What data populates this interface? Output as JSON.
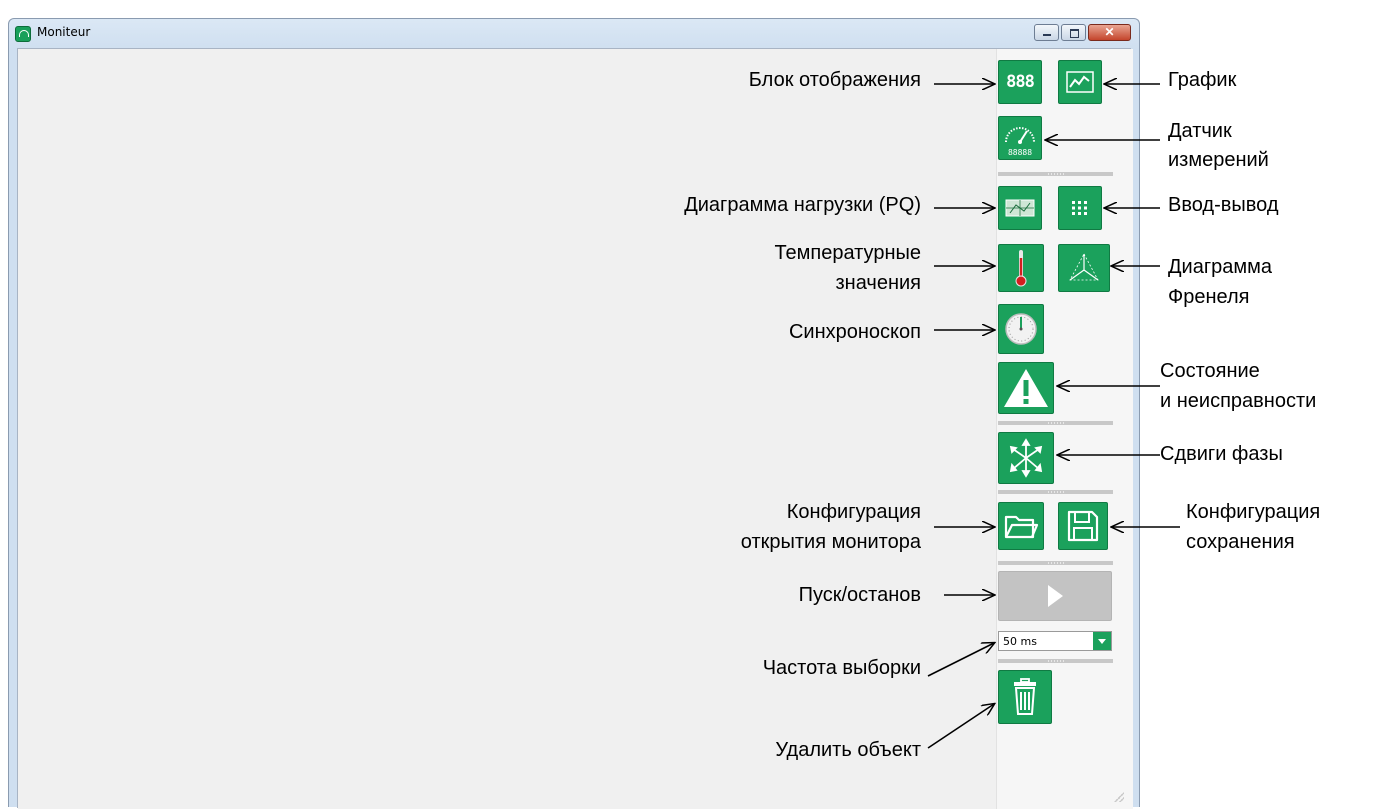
{
  "window": {
    "title": "Moniteur",
    "controls": {
      "minimize": "minimize",
      "maximize": "maximize",
      "close": "close"
    }
  },
  "toolbar": {
    "display_block_icon_text": "888",
    "gauge_digits": "88888",
    "sampling_rate": {
      "selected": "50 ms"
    }
  },
  "annotations": {
    "display_block": "Блок отображения",
    "chart": "График",
    "gauge_line1": "Датчик",
    "gauge_line2": "измерений",
    "pq_diagram": "Диаграмма нагрузки (PQ)",
    "io": "Ввод-вывод",
    "temp_line1": "Температурные",
    "temp_line2": "значения",
    "fresnel_line1": "Диаграмма",
    "fresnel_line2": "Френеля",
    "synchroscope": "Синхроноскоп",
    "status_line1": "Состояние",
    "status_line2": "и неисправности",
    "phase_shifts": "Сдвиги фазы",
    "open_config_line1": "Конфигурация",
    "open_config_line2": "открытия монитора",
    "save_config_line1": "Конфигурация",
    "save_config_line2": "сохранения",
    "start_stop": "Пуск/останов",
    "sampling_rate": "Частота выборки",
    "delete_object": "Удалить объект"
  },
  "colors": {
    "accent": "#1ba15c",
    "disabled": "#c3c3c3"
  }
}
